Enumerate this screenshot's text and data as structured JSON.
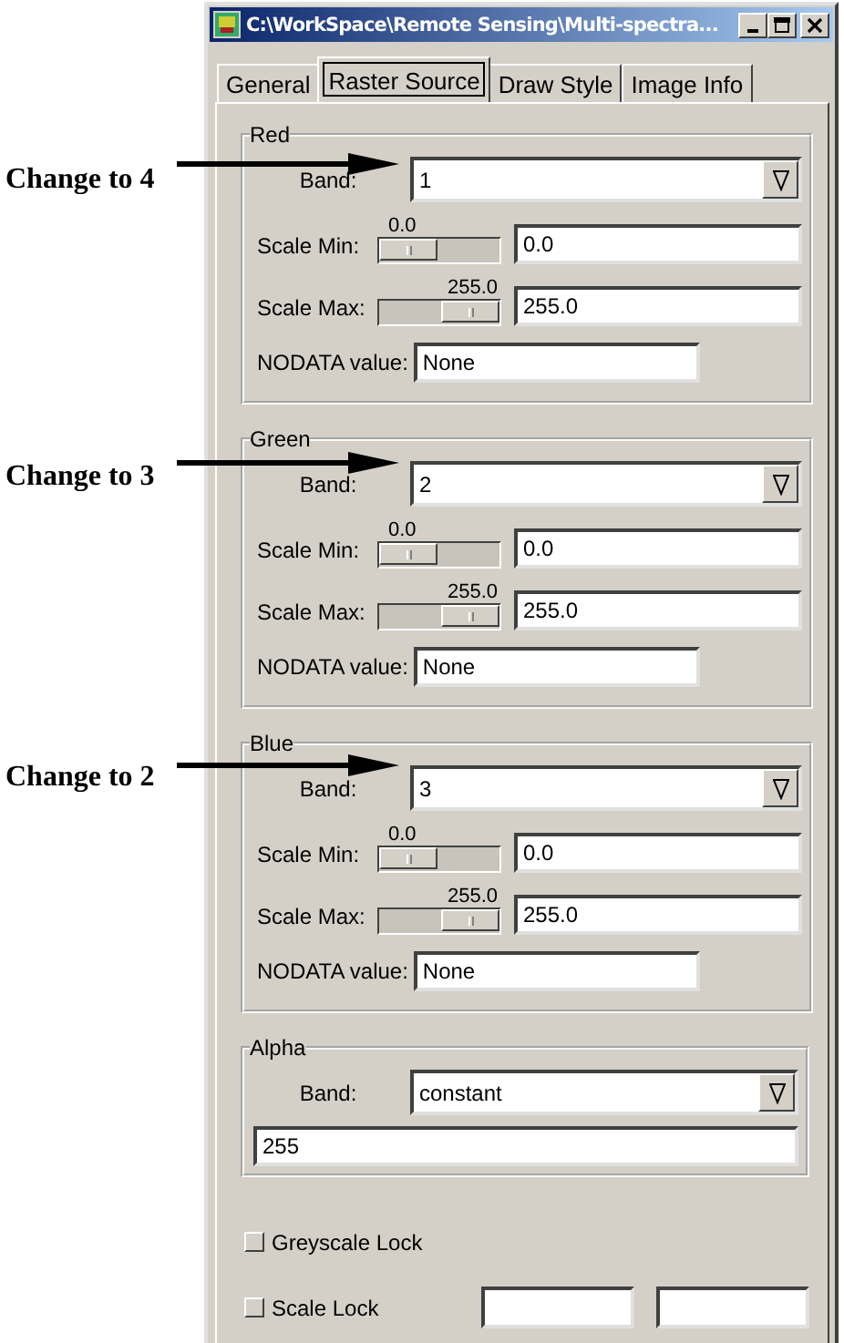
{
  "window": {
    "title": "C:\\WorkSpace\\Remote Sensing\\Multi-spectra..."
  },
  "tabs": [
    {
      "label": "General",
      "selected": false
    },
    {
      "label": "Raster Source",
      "selected": true
    },
    {
      "label": "Draw Style",
      "selected": false
    },
    {
      "label": "Image Info",
      "selected": false
    }
  ],
  "channels": [
    {
      "name": "Red",
      "band_label": "Band:",
      "band": "1",
      "scale_min": {
        "label": "Scale Min:",
        "reading": "0.0",
        "value": "0.0"
      },
      "scale_max": {
        "label": "Scale Max:",
        "reading": "255.0",
        "value": "255.0"
      },
      "nodata_label": "NODATA value:",
      "nodata": "None"
    },
    {
      "name": "Green",
      "band_label": "Band:",
      "band": "2",
      "scale_min": {
        "label": "Scale Min:",
        "reading": "0.0",
        "value": "0.0"
      },
      "scale_max": {
        "label": "Scale Max:",
        "reading": "255.0",
        "value": "255.0"
      },
      "nodata_label": "NODATA value:",
      "nodata": "None"
    },
    {
      "name": "Blue",
      "band_label": "Band:",
      "band": "3",
      "scale_min": {
        "label": "Scale Min:",
        "reading": "0.0",
        "value": "0.0"
      },
      "scale_max": {
        "label": "Scale Max:",
        "reading": "255.0",
        "value": "255.0"
      },
      "nodata_label": "NODATA value:",
      "nodata": "None"
    }
  ],
  "alpha": {
    "name": "Alpha",
    "band_label": "Band:",
    "band": "constant",
    "value": "255"
  },
  "checkboxes": [
    {
      "label": "Greyscale Lock",
      "checked": false,
      "kind": "plain"
    },
    {
      "label": "Scale Lock",
      "checked": false,
      "kind": "range"
    }
  ],
  "annotations": [
    {
      "text": "Change to 4"
    },
    {
      "text": "Change to 3"
    },
    {
      "text": "Change to 2"
    }
  ]
}
